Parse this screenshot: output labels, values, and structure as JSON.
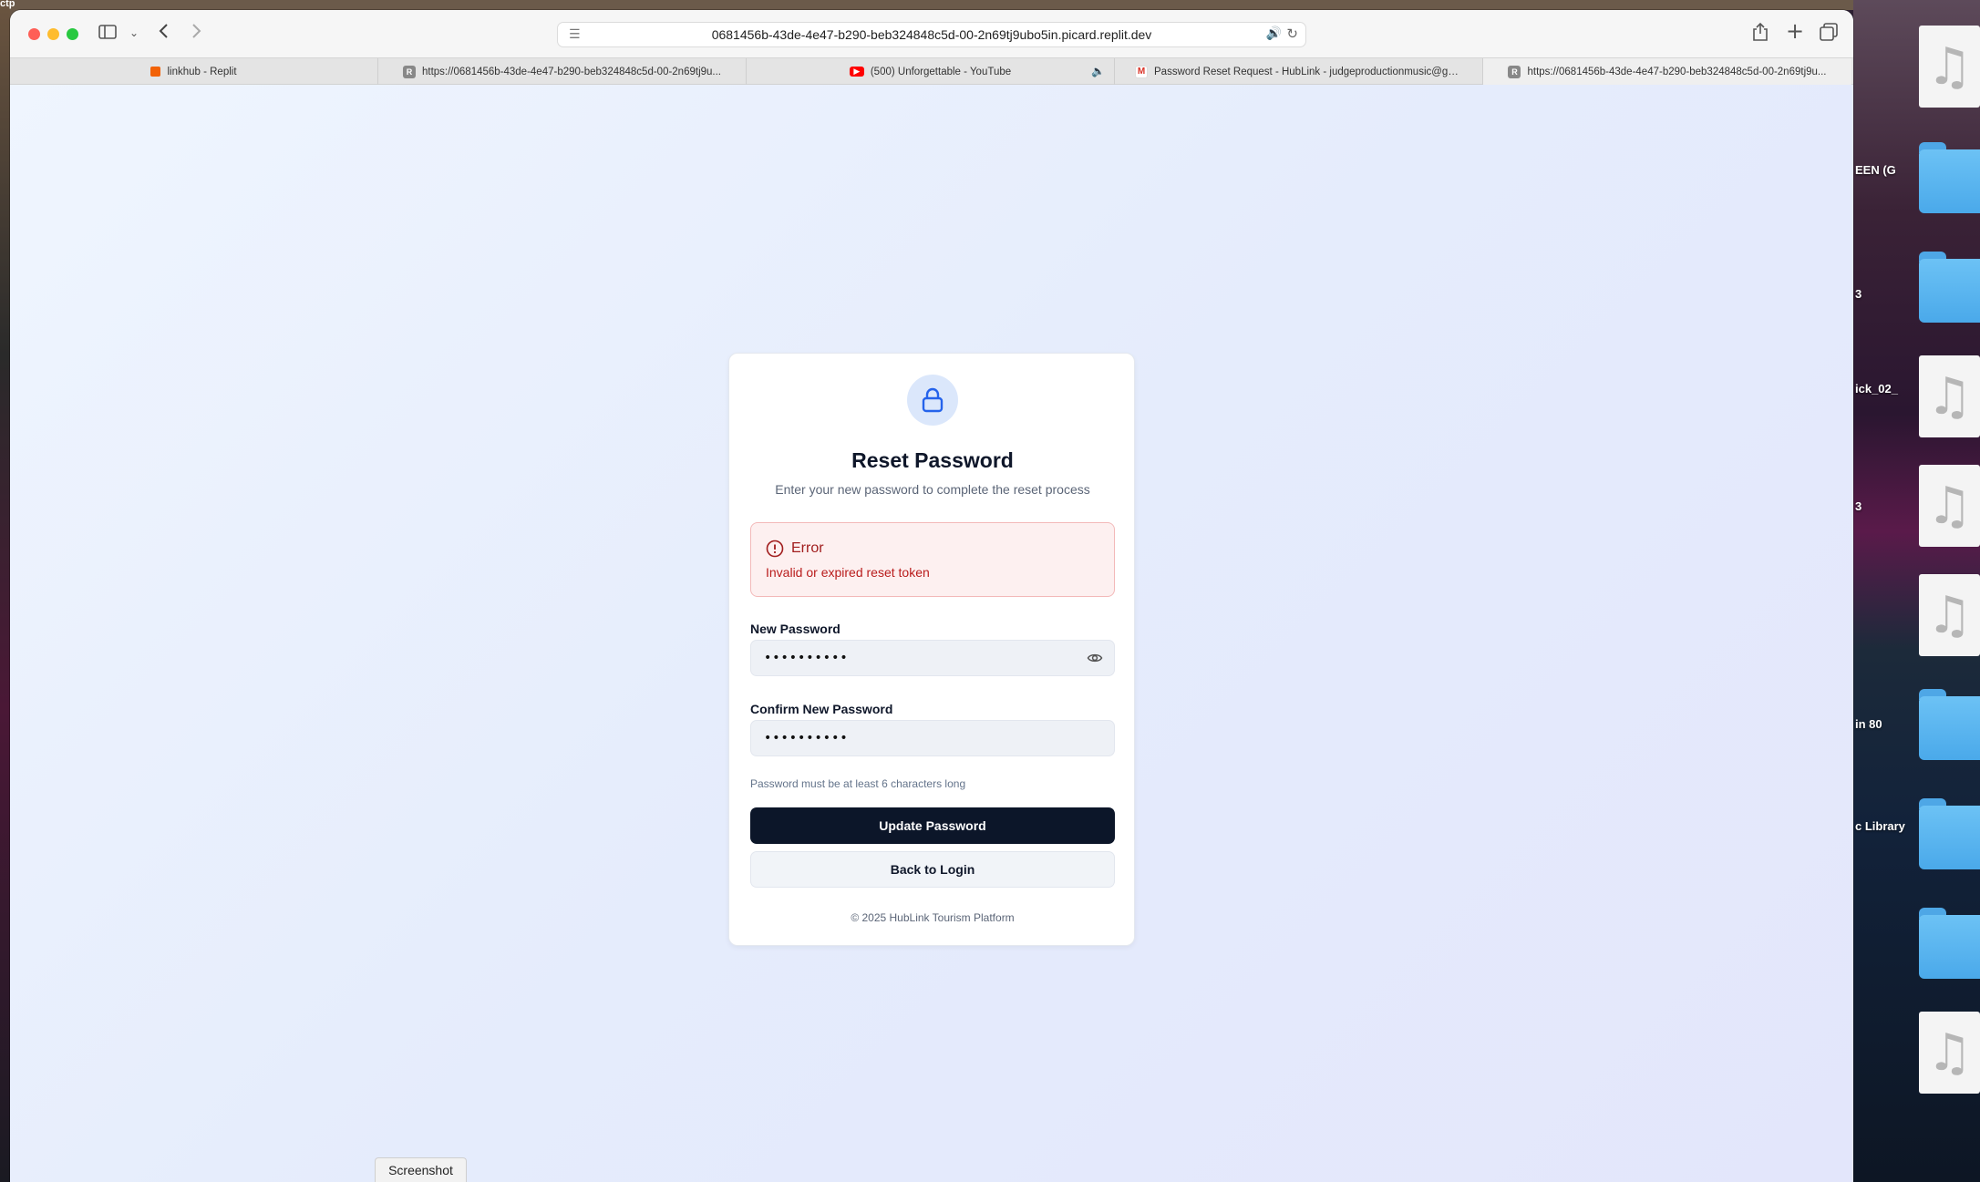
{
  "desktop": {
    "corner_text": "ctp",
    "labels": [
      "EEN (G",
      "3",
      "ick_02_",
      "3",
      "in 80",
      "c Library"
    ]
  },
  "browser": {
    "url": "0681456b-43de-4e47-b290-beb324848c5d-00-2n69tj9ubo5in.picard.replit.dev",
    "tabs": [
      {
        "label": "linkhub - Replit",
        "icon": "replit-icon"
      },
      {
        "label": "https://0681456b-43de-4e47-b290-beb324848c5d-00-2n69tj9u...",
        "icon": "replit-r-icon"
      },
      {
        "label": "(500) Unforgettable - YouTube",
        "icon": "youtube-icon",
        "audio": true
      },
      {
        "label": "Password Reset Request - HubLink - judgeproductionmusic@gmai...",
        "icon": "gmail-icon"
      },
      {
        "label": "https://0681456b-43de-4e47-b290-beb324848c5d-00-2n69tj9u...",
        "icon": "replit-r-icon"
      }
    ]
  },
  "card": {
    "title": "Reset Password",
    "subtitle": "Enter your new password to complete the reset process",
    "alert": {
      "title": "Error",
      "message": "Invalid or expired reset token"
    },
    "new_password": {
      "label": "New Password",
      "value": "••••••••••"
    },
    "confirm_password": {
      "label": "Confirm New Password",
      "value": "••••••••••"
    },
    "hint": "Password must be at least 6 characters long",
    "submit_label": "Update Password",
    "back_label": "Back to Login",
    "footer": "© 2025 HubLink Tourism Platform"
  },
  "overlay": {
    "screenshot_label": "Screenshot"
  },
  "colors": {
    "primary_button": "#0c1629",
    "error_text": "#b91c1c",
    "lock_accent": "#2563eb"
  }
}
